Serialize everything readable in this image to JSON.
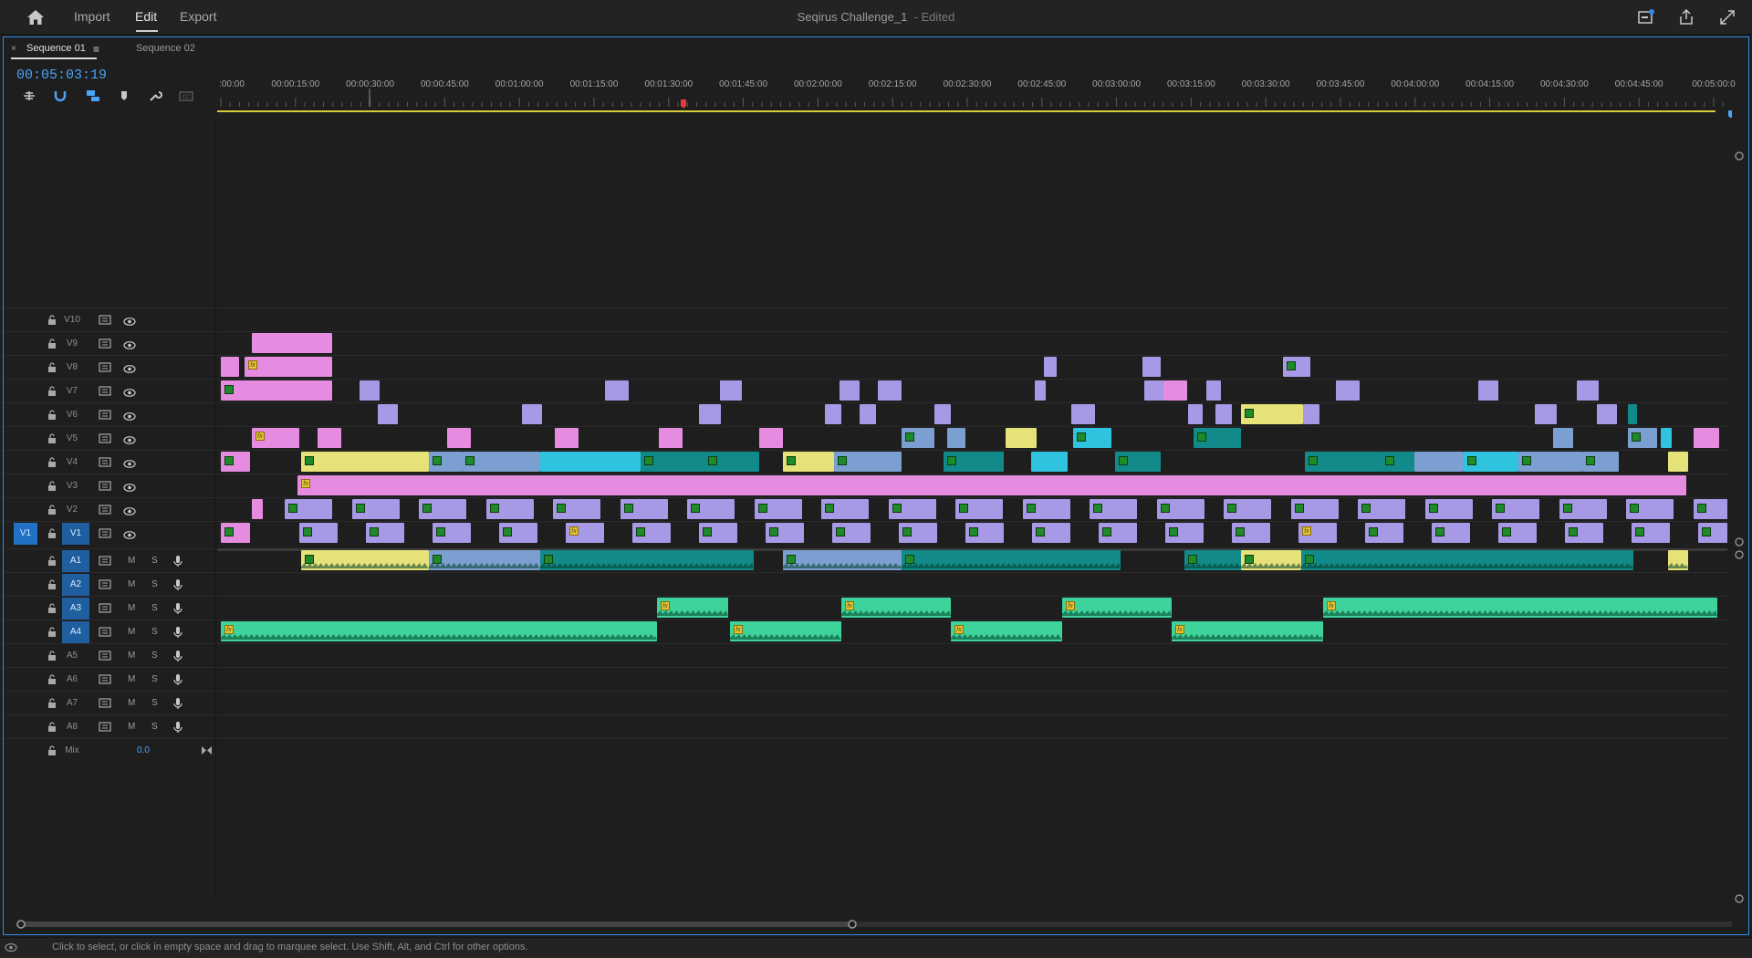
{
  "topbar": {
    "nav": [
      {
        "label": "Import",
        "active": false
      },
      {
        "label": "Edit",
        "active": true
      },
      {
        "label": "Export",
        "active": false
      }
    ],
    "title": "Seqirus Challenge_1",
    "title_suffix": "- Edited",
    "icons": [
      "home-icon",
      "quick-export-icon",
      "share-icon",
      "fullscreen-icon"
    ]
  },
  "sequence_tabs": [
    {
      "label": "Sequence 01",
      "active": true
    },
    {
      "label": "Sequence 02",
      "active": false
    }
  ],
  "timecode": "00:05:03:19",
  "ruler_labels": [
    ":00:00",
    "00:00:15:00",
    "00:00:30:00",
    "00:00:45:00",
    "00:01:00:00",
    "00:01:15:00",
    "00:01:30:00",
    "00:01:45:00",
    "00:02:00:00",
    "00:02:15:00",
    "00:02:30:00",
    "00:02:45:00",
    "00:03:00:00",
    "00:03:15:00",
    "00:03:30:00",
    "00:03:45:00",
    "00:04:00:00",
    "00:04:15:00",
    "00:04:30:00",
    "00:04:45:00",
    "00:05:00:0"
  ],
  "video_tracks": [
    "V10",
    "V9",
    "V8",
    "V7",
    "V6",
    "V5",
    "V4",
    "V3",
    "V2",
    "V1"
  ],
  "audio_tracks": [
    "A1",
    "A2",
    "A3",
    "A4",
    "A5",
    "A6",
    "A7",
    "A8"
  ],
  "source_patch_video": "V1",
  "track_buttons": {
    "mute": "M",
    "solo": "S"
  },
  "mix": {
    "label": "Mix",
    "value": "0.0"
  },
  "status_text": "Click to select, or click in empty space and drag to marquee select. Use Shift, Alt, and Ctrl for other options.",
  "colors": {
    "accent": "#2d8ceb",
    "clip_pink": "#e58ce0",
    "clip_violet": "#a899e6",
    "clip_yellow": "#e6e27a",
    "clip_cyan": "#2fc3e0",
    "clip_teal": "#128a8a",
    "clip_slate": "#7a9fd0",
    "clip_audio_green": "#3ed39a"
  }
}
